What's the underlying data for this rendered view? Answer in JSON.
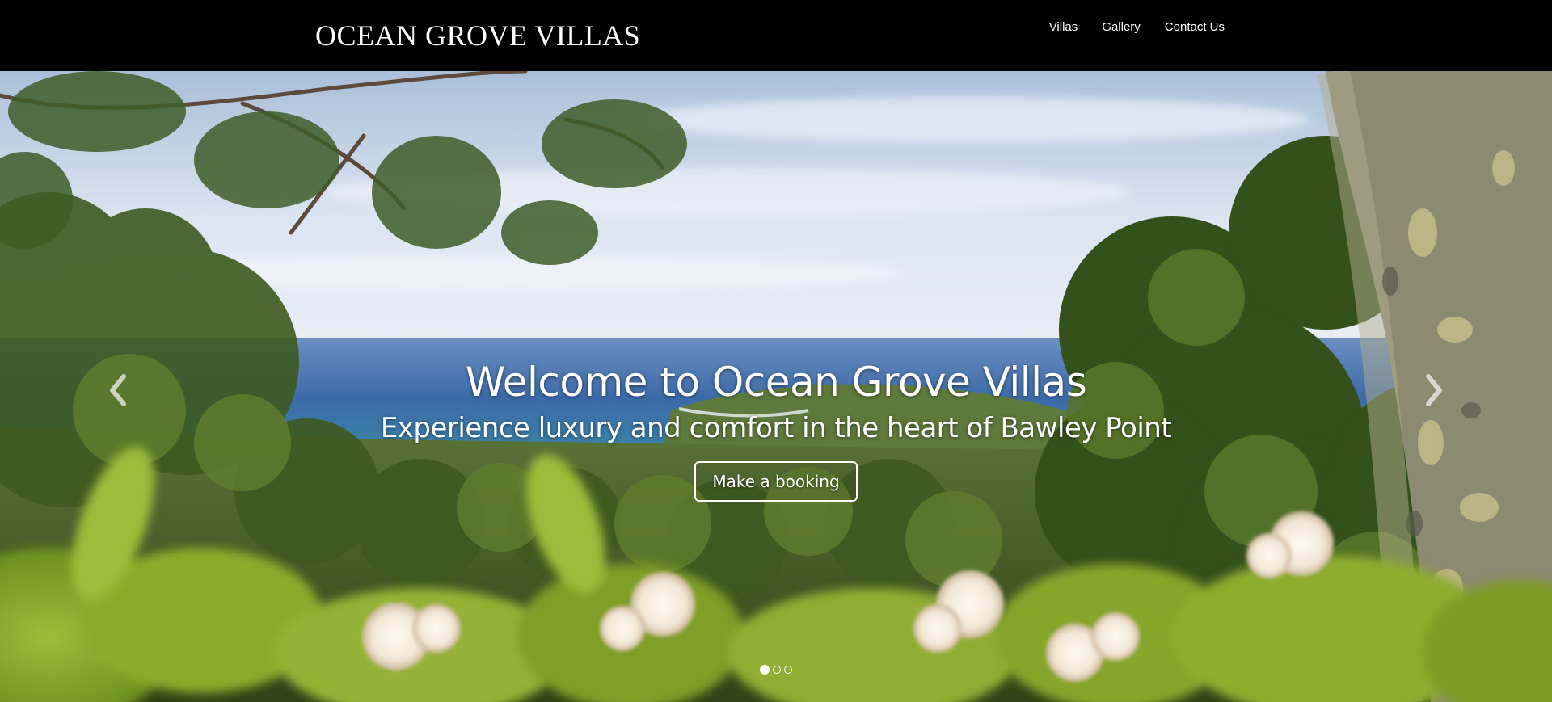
{
  "header": {
    "brand": "OCEAN GROVE VILLAS",
    "nav": [
      {
        "label": "Villas"
      },
      {
        "label": "Gallery"
      },
      {
        "label": "Contact Us"
      }
    ]
  },
  "hero": {
    "title": "Welcome to Ocean Grove Villas",
    "subtitle": "Experience luxury and comfort in the heart of Bawley Point",
    "cta_label": "Make a booking",
    "carousel": {
      "slide_count": 3,
      "active_index": 0,
      "prev_icon": "chevron-left-icon",
      "next_icon": "chevron-right-icon"
    }
  },
  "colors": {
    "header_bg": "#000000",
    "text": "#ffffff",
    "sky": "#c9d8ec",
    "ocean": "#3f6fae",
    "foliage": "#4d6b2a"
  }
}
